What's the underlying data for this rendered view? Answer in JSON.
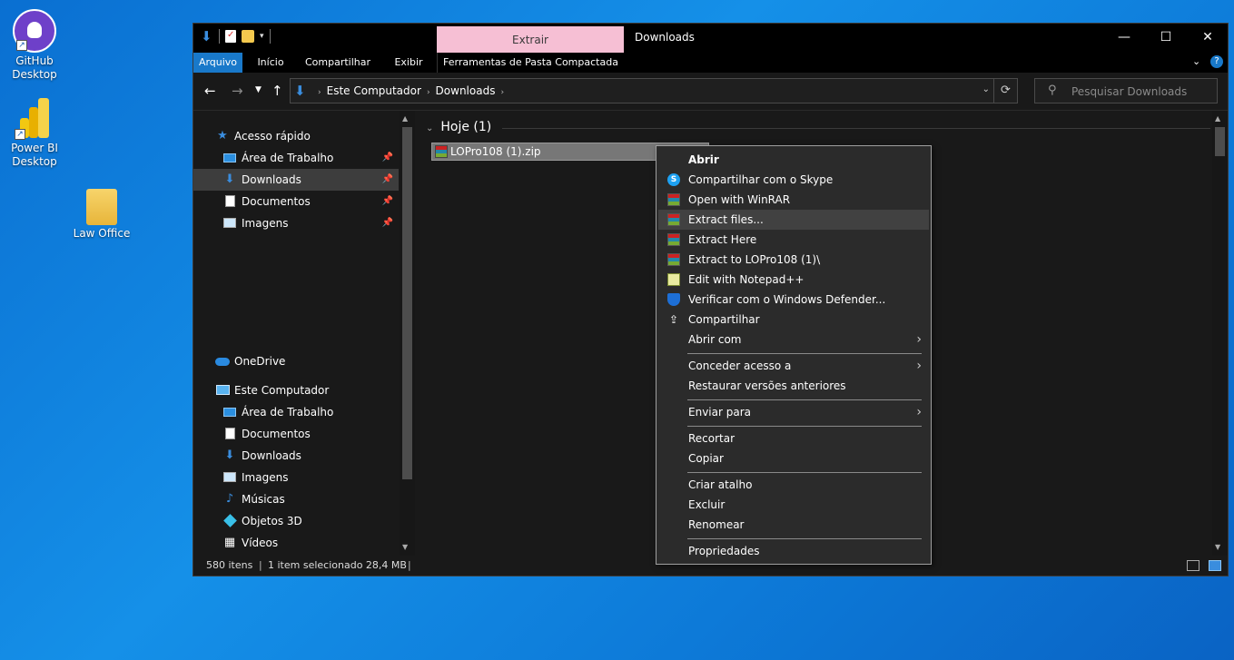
{
  "desktop": {
    "icons": [
      {
        "label": "GitHub Desktop"
      },
      {
        "label": "Power BI Desktop"
      },
      {
        "label": "Law Office"
      }
    ]
  },
  "window": {
    "title": "Downloads",
    "tool_tab": "Extrair",
    "ribbon_tabs": [
      "Arquivo",
      "Início",
      "Compartilhar",
      "Exibir",
      "Ferramentas de Pasta Compactada"
    ],
    "controls": {
      "minimize": "—",
      "maximize": "☐",
      "close": "✕"
    }
  },
  "address": {
    "crumbs": [
      "Este Computador",
      "Downloads"
    ],
    "search_placeholder": "Pesquisar Downloads"
  },
  "nav": {
    "quick_access": "Acesso rápido",
    "quick_items": [
      "Área de Trabalho",
      "Downloads",
      "Documentos",
      "Imagens"
    ],
    "onedrive": "OneDrive",
    "this_pc": "Este Computador",
    "pc_items": [
      "Área de Trabalho",
      "Documentos",
      "Downloads",
      "Imagens",
      "Músicas",
      "Objetos 3D",
      "Vídeos"
    ]
  },
  "content": {
    "group_label": "Hoje (1)",
    "selected_file": "LOPro108 (1).zip"
  },
  "status": {
    "items": "580 itens",
    "selected": "1 item selecionado  28,4 MB"
  },
  "context_menu": {
    "items": [
      {
        "label": "Abrir"
      },
      {
        "label": "Compartilhar com o Skype"
      },
      {
        "label": "Open with WinRAR"
      },
      {
        "label": "Extract files..."
      },
      {
        "label": "Extract Here"
      },
      {
        "label": "Extract to LOPro108 (1)\\"
      },
      {
        "label": "Edit with Notepad++"
      },
      {
        "label": "Verificar com o Windows Defender..."
      },
      {
        "label": "Compartilhar"
      },
      {
        "label": "Abrir com"
      },
      {
        "label": "Conceder acesso a"
      },
      {
        "label": "Restaurar versões anteriores"
      },
      {
        "label": "Enviar para"
      },
      {
        "label": "Recortar"
      },
      {
        "label": "Copiar"
      },
      {
        "label": "Criar atalho"
      },
      {
        "label": "Excluir"
      },
      {
        "label": "Renomear"
      },
      {
        "label": "Propriedades"
      }
    ]
  }
}
